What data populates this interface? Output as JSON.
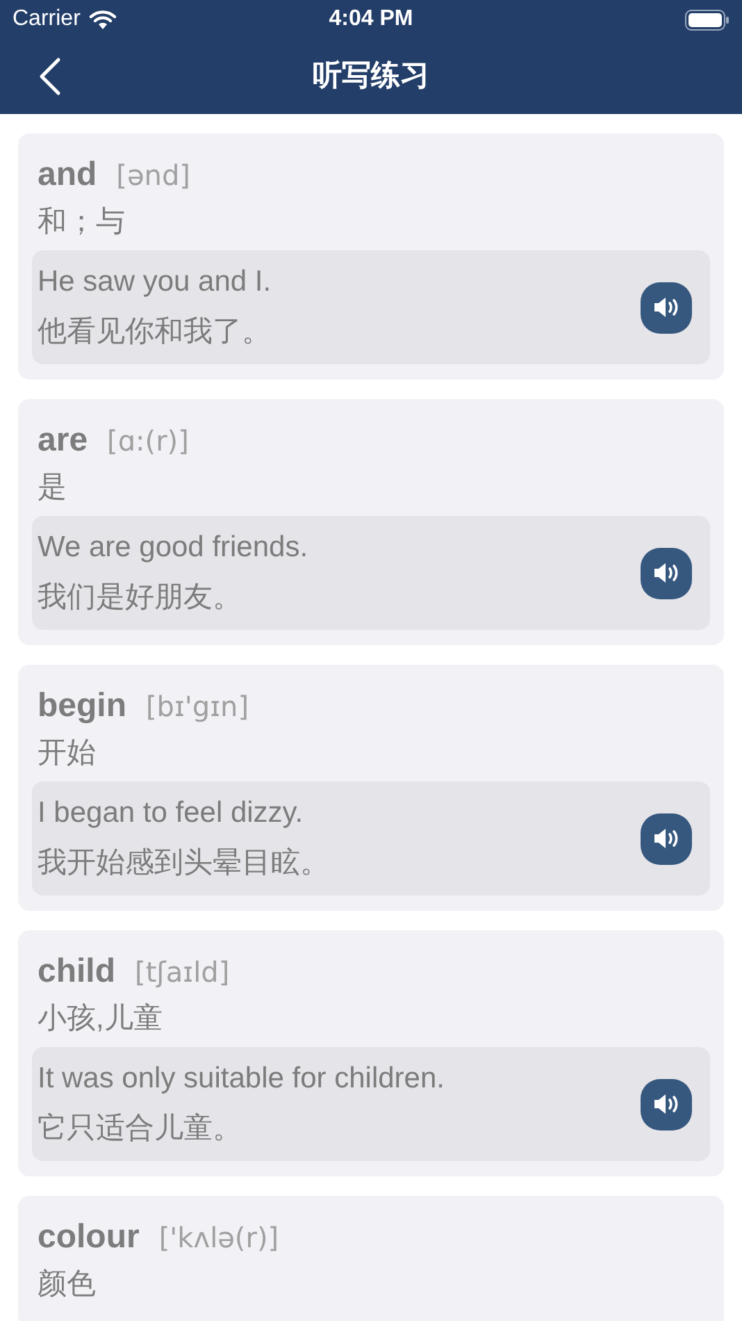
{
  "status_bar": {
    "carrier": "Carrier",
    "time": "4:04 PM"
  },
  "nav": {
    "title": "听写练习"
  },
  "words": [
    {
      "word": "and",
      "phonetic": "[ənd]",
      "meaning": "和；与",
      "example": {
        "en": "He saw you and I.",
        "zh": "他看见你和我了。"
      }
    },
    {
      "word": "are",
      "phonetic": "[ɑ:(r)]",
      "meaning": "是",
      "example": {
        "en": "We are good friends.",
        "zh": "我们是好朋友。"
      }
    },
    {
      "word": "begin",
      "phonetic": "[bɪ'gɪn]",
      "meaning": "开始",
      "example": {
        "en": "I began to feel dizzy.",
        "zh": "我开始感到头晕目眩。"
      }
    },
    {
      "word": "child",
      "phonetic": "[tʃaɪld]",
      "meaning": "小孩,儿童",
      "example": {
        "en": "It was only suitable for children.",
        "zh": "它只适合儿童。"
      }
    },
    {
      "word": "colour",
      "phonetic": "['kʌlə(r)]",
      "meaning": "颜色"
    }
  ]
}
